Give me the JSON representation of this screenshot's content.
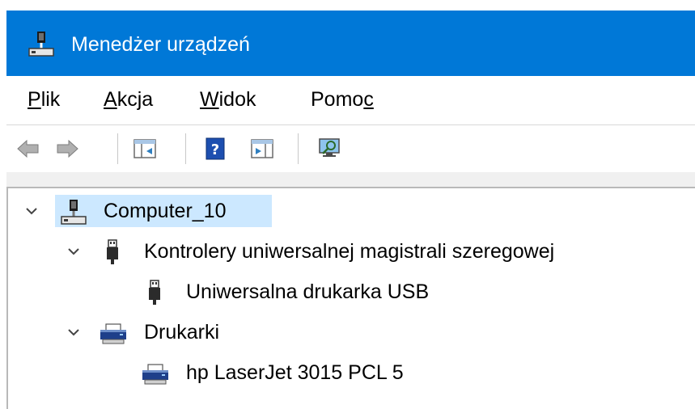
{
  "window": {
    "title": "Menedżer urządzeń",
    "title_icon": "device-manager-icon",
    "accent_color": "#0078d7"
  },
  "menu": {
    "items": [
      {
        "pre": "",
        "key": "P",
        "post": "lik"
      },
      {
        "pre": "",
        "key": "A",
        "post": "kcja"
      },
      {
        "pre": "",
        "key": "W",
        "post": "idok"
      },
      {
        "pre": "Pomo",
        "key": "c",
        "post": ""
      }
    ]
  },
  "toolbar": {
    "buttons": [
      "back-arrow-icon",
      "forward-arrow-icon",
      "show-hide-console-tree-icon",
      "help-icon",
      "show-hide-action-pane-icon",
      "scan-hardware-icon"
    ]
  },
  "tree": {
    "selection_color": "#cce8ff",
    "root": {
      "label": "Computer_10",
      "icon": "computer-icon",
      "expanded": true,
      "selected": true
    },
    "usb_group": {
      "label": "Kontrolery uniwersalnej magistrali szeregowej",
      "icon": "usb-plug-icon",
      "expanded": true
    },
    "usb_device": {
      "label": "Uniwersalna drukarka USB",
      "icon": "usb-plug-icon"
    },
    "printers_group": {
      "label": "Drukarki",
      "icon": "printer-icon",
      "expanded": true
    },
    "printer_device": {
      "label": "hp LaserJet 3015 PCL 5",
      "icon": "printer-icon"
    }
  }
}
